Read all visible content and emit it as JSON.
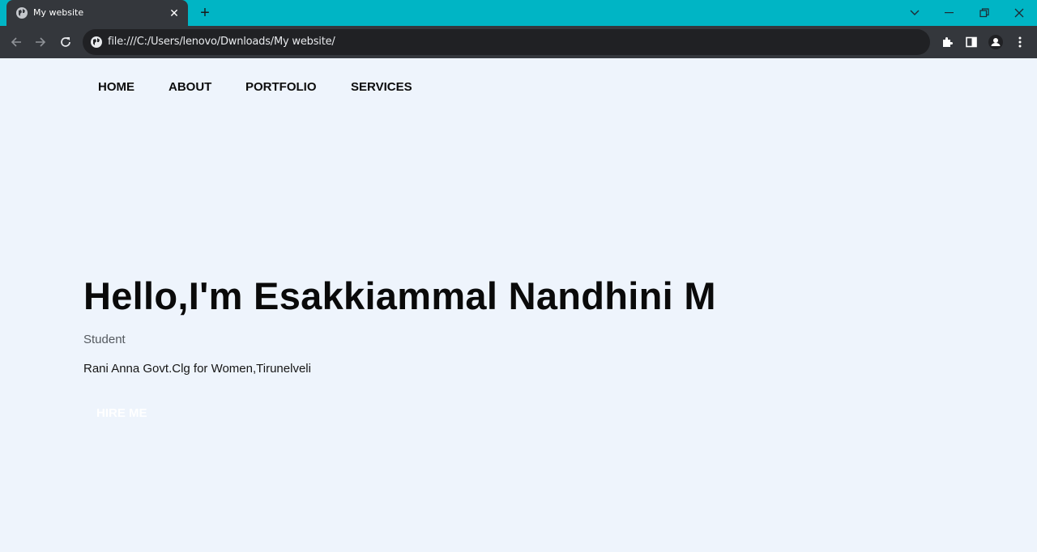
{
  "browser": {
    "tab_title": "My website",
    "tab_close": "✕",
    "new_tab": "+",
    "url": "file:///C:/Users/lenovo/Dwnloads/My website/",
    "accent_color": "#00b5c5"
  },
  "nav": {
    "items": [
      {
        "label": "HOME"
      },
      {
        "label": "ABOUT"
      },
      {
        "label": "PORTFOLIO"
      },
      {
        "label": "SERVICES"
      }
    ]
  },
  "hero": {
    "title": "Hello,I'm Esakkiammal Nandhini M",
    "role": "Student",
    "college": "Rani Anna Govt.Clg for Women,Tirunelveli",
    "button_label": "HIRE ME"
  }
}
